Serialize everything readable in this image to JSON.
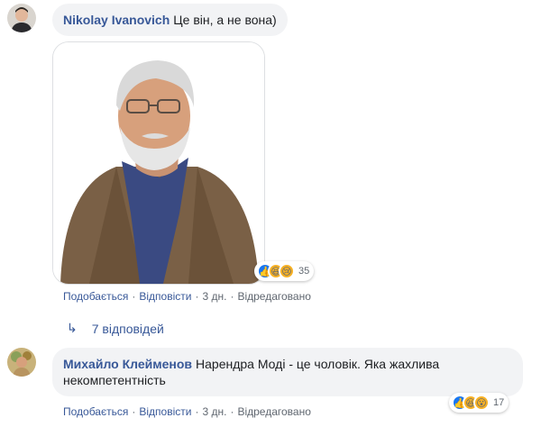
{
  "comments": [
    {
      "author": "Nikolay Ivanovich",
      "text": "Це він, а не вона)",
      "reaction_count": "35",
      "reactions": [
        "like-icon",
        "haha-icon",
        "sad-icon"
      ],
      "actions": {
        "like": "Подобається",
        "reply": "Відповісти",
        "time": "3 дн.",
        "edited": "Відредаговано"
      },
      "replies_label": "7 відповідей"
    },
    {
      "author": "Михайло Клейменов",
      "text_line1": "Нарендра Моді - це чоловік. Яка жахлива",
      "text_line2": "некомпетентність",
      "reaction_count": "17",
      "reactions": [
        "like-icon",
        "haha-icon",
        "wow-icon"
      ],
      "actions": {
        "like": "Подобається",
        "reply": "Відповісти",
        "time": "3 дн.",
        "edited": "Відредаговано"
      }
    }
  ],
  "colors": {
    "link": "#385898",
    "bubble": "#f2f3f5",
    "like": "#1877f2",
    "emoji": "#f7b125"
  }
}
